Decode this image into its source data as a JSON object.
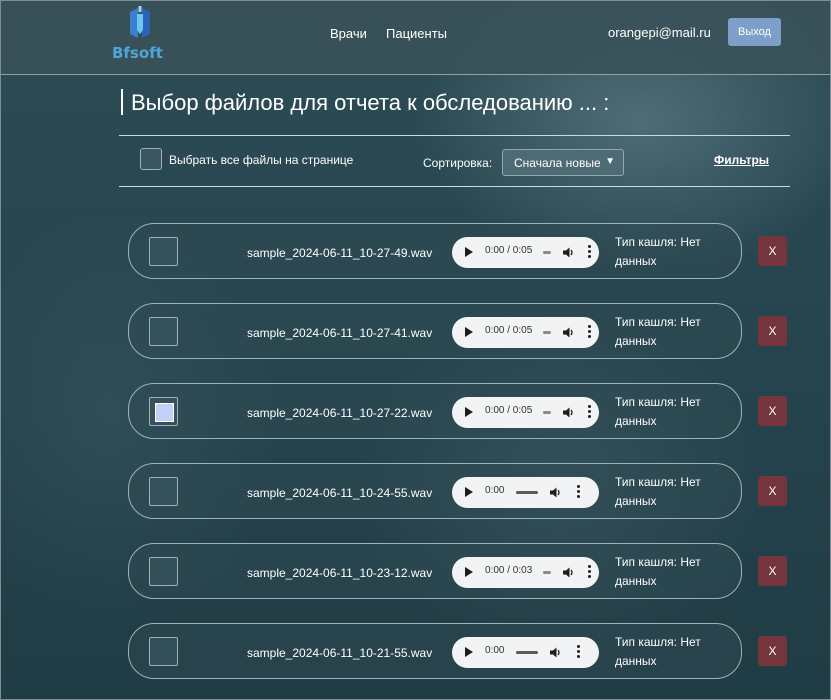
{
  "header": {
    "logo_text": "Bfsoft",
    "nav": [
      "Врачи",
      "Пациенты"
    ],
    "user_email": "orangepi@mail.ru",
    "logout_label": "Выход"
  },
  "page": {
    "title": "Выбор файлов для отчета к обследованию ... :"
  },
  "toolbar": {
    "select_all_label": "Выбрать все файлы на странице",
    "sort_label": "Сортировка:",
    "sort_value": "Сначала новые",
    "filters_label": "Фильтры"
  },
  "files": [
    {
      "name": "sample_2024-06-11_10-27-49.wav",
      "time": "0:00 / 0:05",
      "cough_label": "Тип кашля: Нет данных",
      "checked": false,
      "delete_label": "X"
    },
    {
      "name": "sample_2024-06-11_10-27-41.wav",
      "time": "0:00 / 0:05",
      "cough_label": "Тип кашля: Нет данных",
      "checked": false,
      "delete_label": "X"
    },
    {
      "name": "sample_2024-06-11_10-27-22.wav",
      "time": "0:00 / 0:05",
      "cough_label": "Тип кашля: Нет данных",
      "checked": true,
      "delete_label": "X"
    },
    {
      "name": "sample_2024-06-11_10-24-55.wav",
      "time": "0:00",
      "cough_label": "Тип кашля: Нет данных",
      "checked": false,
      "delete_label": "X"
    },
    {
      "name": "sample_2024-06-11_10-23-12.wav",
      "time": "0:00 / 0:03",
      "cough_label": "Тип кашля: Нет данных",
      "checked": false,
      "delete_label": "X"
    },
    {
      "name": "sample_2024-06-11_10-21-55.wav",
      "time": "0:00",
      "cough_label": "Тип кашля: Нет данных",
      "checked": false,
      "delete_label": "X"
    }
  ]
}
